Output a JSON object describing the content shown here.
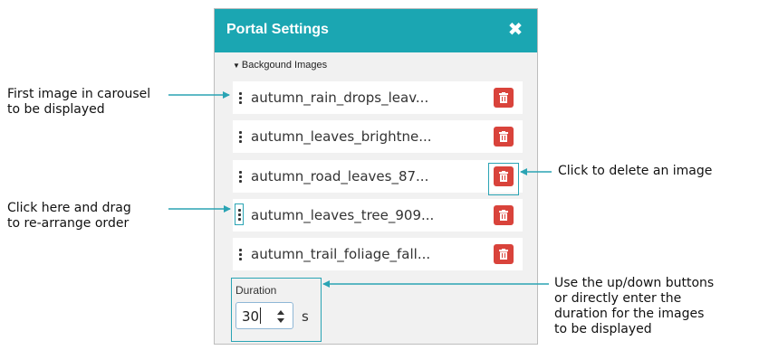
{
  "panel": {
    "title": "Portal Settings",
    "close_icon": "close-icon",
    "section_label": "Backgound Images",
    "images": [
      {
        "name": "autumn_rain_drops_leav..."
      },
      {
        "name": "autumn_leaves_brightne..."
      },
      {
        "name": "autumn_road_leaves_87..."
      },
      {
        "name": "autumn_leaves_tree_909..."
      },
      {
        "name": "autumn_trail_foliage_fall..."
      }
    ],
    "duration": {
      "label": "Duration",
      "value": "30",
      "unit": "s"
    }
  },
  "annotations": {
    "first_image_line1": "First image in carousel",
    "first_image_line2": "to be displayed",
    "drag_line1": "Click here and drag",
    "drag_line2": "to re-arrange order",
    "delete": "Click to delete an image",
    "duration_line1": "Use the up/down buttons",
    "duration_line2": "or directly enter the",
    "duration_line3": "duration for the images",
    "duration_line4": "to be displayed"
  },
  "colors": {
    "header_bg": "#1ba6b2",
    "delete_button": "#d9433b",
    "callout_line": "#2aa4b4"
  }
}
